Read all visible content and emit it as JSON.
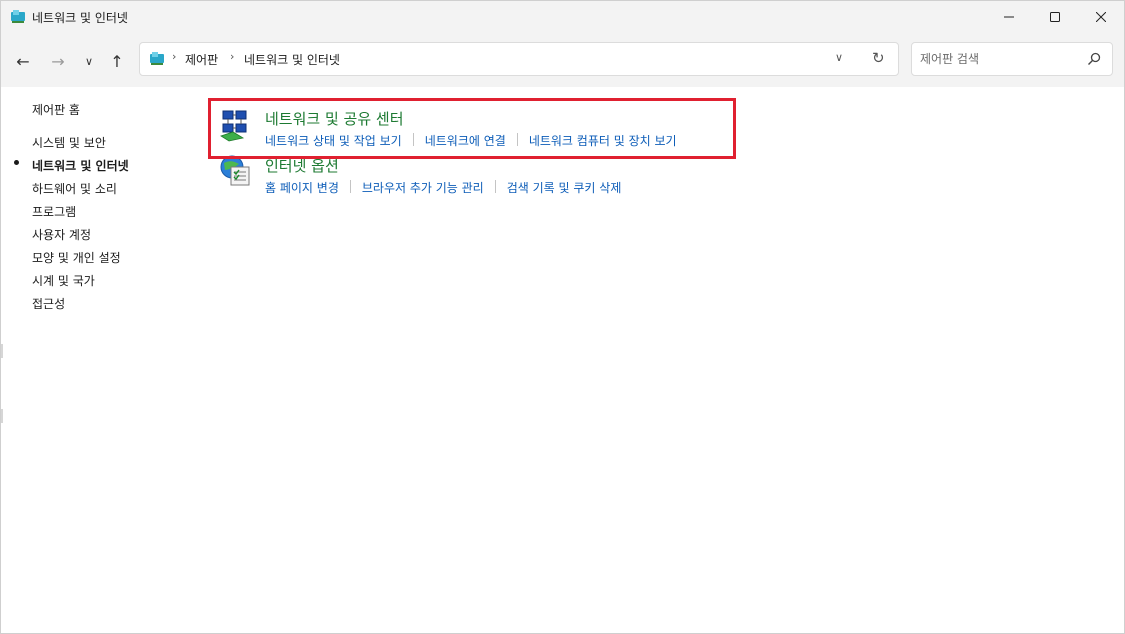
{
  "window": {
    "title": "네트워크 및 인터넷",
    "minimize_glyph": "—",
    "maximize_glyph": "☐",
    "close_glyph": "✕"
  },
  "nav": {
    "back_glyph": "←",
    "forward_glyph": "→",
    "recent_glyph": "∨",
    "up_glyph": "↑"
  },
  "address": {
    "breadcrumbs": [
      "제어판",
      "네트워크 및 인터넷"
    ],
    "separator": "›",
    "dropdown_glyph": "∨",
    "refresh_glyph": "↻"
  },
  "search": {
    "placeholder": "제어판 검색",
    "value": ""
  },
  "sidebar": {
    "items": [
      {
        "label": "제어판 홈",
        "active": false
      },
      {
        "label": "시스템 및 보안",
        "active": false
      },
      {
        "label": "네트워크 및 인터넷",
        "active": true
      },
      {
        "label": "하드웨어 및 소리",
        "active": false
      },
      {
        "label": "프로그램",
        "active": false
      },
      {
        "label": "사용자 계정",
        "active": false
      },
      {
        "label": "모양 및 개인 설정",
        "active": false
      },
      {
        "label": "시계 및 국가",
        "active": false
      },
      {
        "label": "접근성",
        "active": false
      }
    ]
  },
  "main": {
    "categories": [
      {
        "title": "네트워크 및 공유 센터",
        "icon": "network-sharing-center-icon",
        "links": [
          "네트워크 상태 및 작업 보기",
          "네트워크에 연결",
          "네트워크 컴퓨터 및 장치 보기"
        ]
      },
      {
        "title": "인터넷 옵션",
        "icon": "internet-options-icon",
        "links": [
          "홈 페이지 변경",
          "브라우저 추가 기능 관리",
          "검색 기록 및 쿠키 삭제"
        ]
      }
    ]
  },
  "colors": {
    "category_title": "#1d7a32",
    "link": "#0d5db8",
    "highlight_border": "#e02030",
    "chrome_background": "#f3f3f3"
  }
}
